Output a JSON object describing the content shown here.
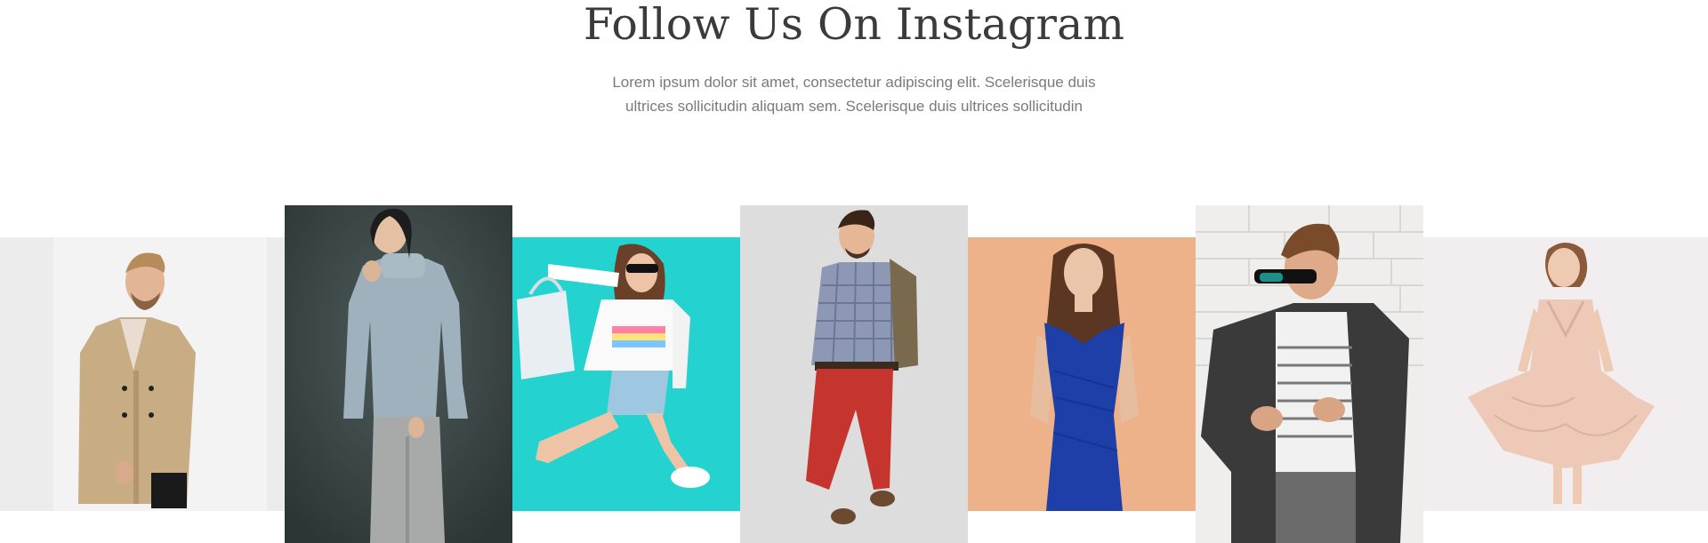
{
  "section": {
    "title": "Follow Us On Instagram",
    "subtitle_line1": "Lorem ipsum dolor sit amet, consectetur adipiscing elit. Scelerisque duis",
    "subtitle_line2": "ultrices sollicitudin aliquam sem. Scelerisque duis ultrices sollicitudin"
  },
  "colors": {
    "title": "#3b3b3b",
    "subtitle": "#7a7a7a",
    "background": "#ffffff"
  }
}
